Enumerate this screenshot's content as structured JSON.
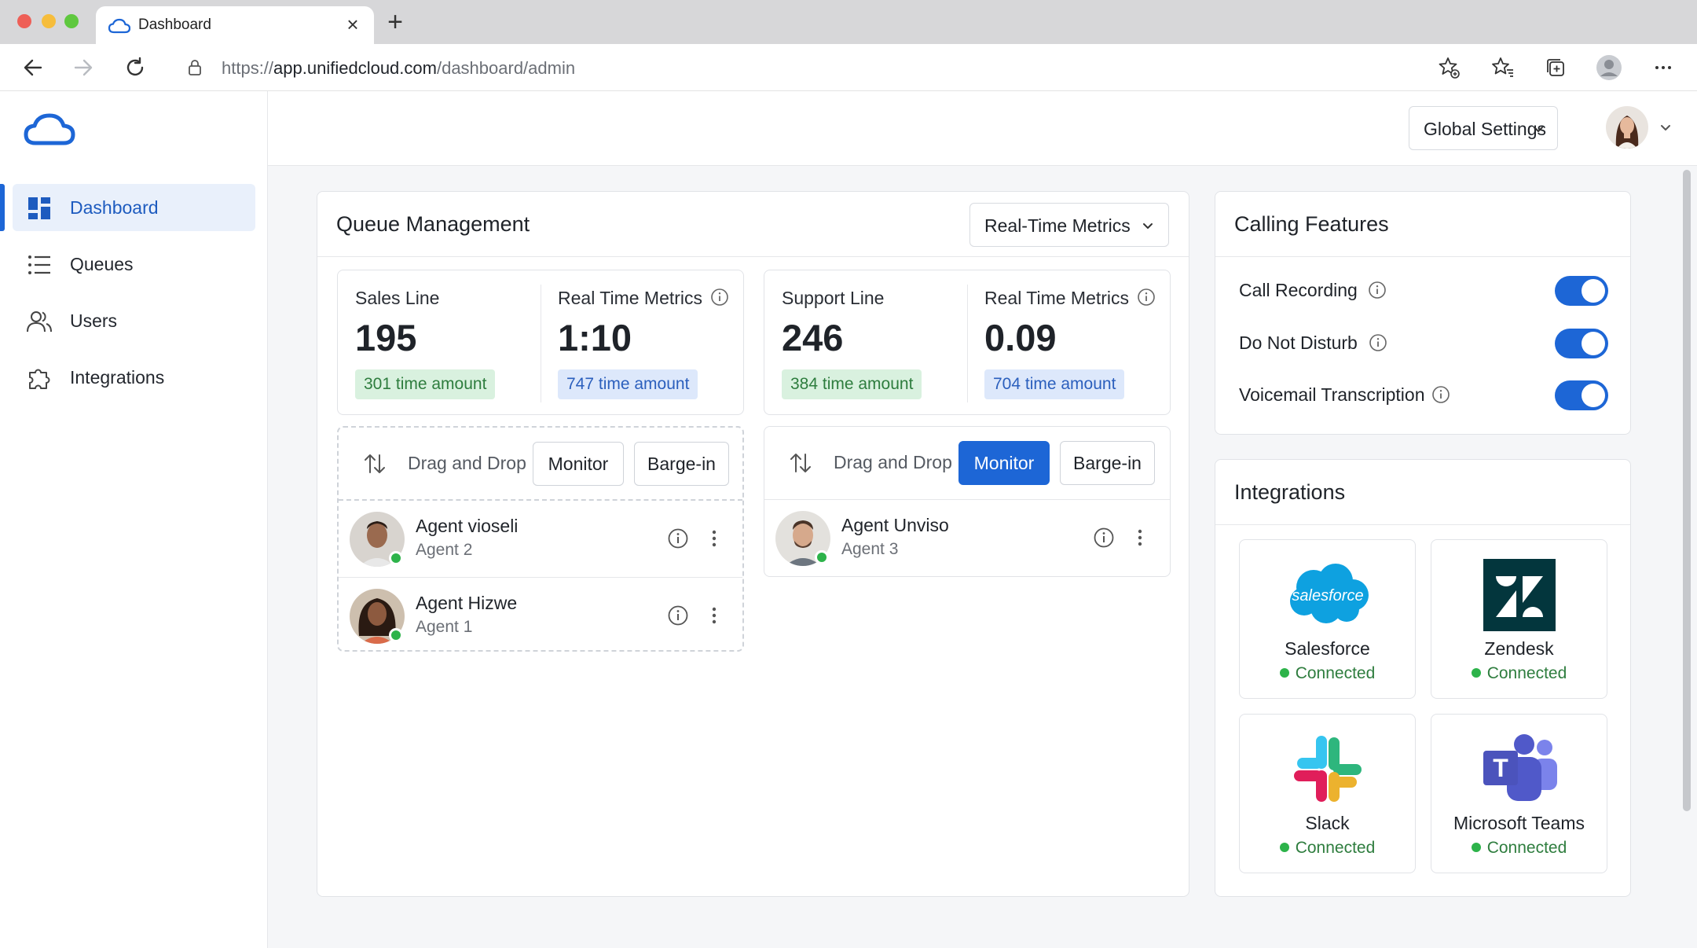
{
  "browser": {
    "tab_title": "Dashboard",
    "url_prefix": "https://",
    "url_host": "app.unifiedcloud.com",
    "url_path": "/dashboard/admin"
  },
  "sidebar": {
    "items": [
      {
        "label": "Dashboard",
        "icon": "dashboard-icon",
        "active": true
      },
      {
        "label": "Queues",
        "icon": "list-icon"
      },
      {
        "label": "Users",
        "icon": "users-icon"
      },
      {
        "label": "Integrations",
        "icon": "puzzle-icon"
      }
    ]
  },
  "header": {
    "global_settings_label": "Global Settings"
  },
  "queue": {
    "title": "Queue Management",
    "metrics_dropdown": "Real-Time Metrics",
    "lines": [
      {
        "name": "Sales Line",
        "value": "195",
        "pill": "301 time amount",
        "metric_label": "Real Time Metrics",
        "metric_value": "1:10",
        "metric_pill": "747 time amount",
        "toolbar": {
          "drag_label": "Drag and Drop",
          "monitor_label": "Monitor",
          "barge_label": "Barge-in",
          "monitor_active": false
        },
        "agents": [
          {
            "name": "Agent vioseli",
            "role": "Agent 2"
          },
          {
            "name": "Agent Hizwe",
            "role": "Agent 1"
          }
        ]
      },
      {
        "name": "Support Line",
        "value": "246",
        "pill": "384 time amount",
        "metric_label": "Real Time Metrics",
        "metric_value": "0.09",
        "metric_pill": "704 time amount",
        "toolbar": {
          "drag_label": "Drag and Drop",
          "monitor_label": "Monitor",
          "barge_label": "Barge-in",
          "monitor_active": true
        },
        "agents": [
          {
            "name": "Agent Unviso",
            "role": "Agent 3"
          }
        ]
      }
    ]
  },
  "calling_features": {
    "title": "Calling Features",
    "items": [
      {
        "label": "Call Recording",
        "enabled": true
      },
      {
        "label": "Do Not Disturb",
        "enabled": true
      },
      {
        "label": "Voicemail Transcription",
        "enabled": true
      }
    ]
  },
  "integrations": {
    "title": "Integrations",
    "items": [
      {
        "name": "Salesforce",
        "status": "Connected",
        "logo_text": "salesforce"
      },
      {
        "name": "Zendesk",
        "status": "Connected"
      },
      {
        "name": "Slack",
        "status": "Connected"
      },
      {
        "name": "Microsoft Teams",
        "status": "Connected",
        "logo_text": "T"
      }
    ]
  },
  "colors": {
    "accent": "#1d66d6",
    "online": "#2db34a",
    "pill_green_bg": "#d9f1df",
    "pill_blue_bg": "#dde8fb"
  }
}
